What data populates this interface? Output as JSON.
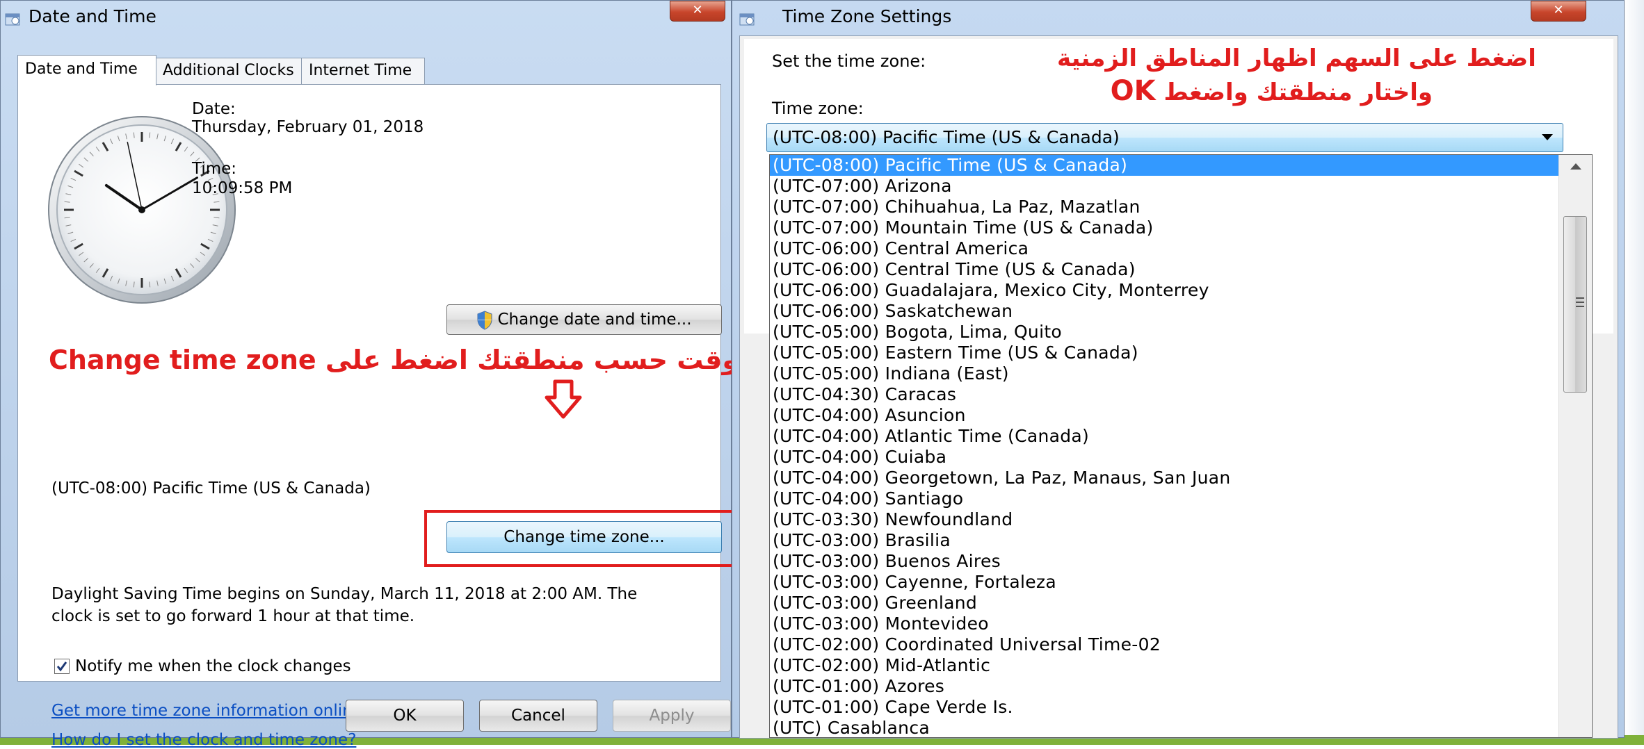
{
  "date_time_window": {
    "title": "Date and Time",
    "close_glyph": "✕",
    "tabs": [
      {
        "label": "Date and Time",
        "active": true
      },
      {
        "label": "Additional Clocks",
        "active": false
      },
      {
        "label": "Internet Time",
        "active": false
      }
    ],
    "clock_time": "10:09:58",
    "date_label": "Date:",
    "date_value": "Thursday, February 01, 2018",
    "time_label": "Time:",
    "time_value": "10:09:58 PM",
    "change_date_button": "Change date and time...",
    "current_timezone": "(UTC-08:00) Pacific Time (US & Canada)",
    "change_tz_button": "Change time zone...",
    "dst_line1": "Daylight Saving Time begins on Sunday, March 11, 2018 at 2:00 AM. The",
    "dst_line2": "clock is set to go forward 1 hour at that time.",
    "notify_checkbox": {
      "label": "Notify me when the clock changes",
      "checked": true
    },
    "link_more_info": "Get more time zone information online",
    "link_how_to": "How do I set the clock and time zone?",
    "ok_button": "OK",
    "cancel_button": "Cancel",
    "apply_button": "Apply"
  },
  "annotations": {
    "left_ar": "لتغيير الوقت حسب منطقتك اضغط على",
    "left_en": "Change time zone",
    "right_line1": "اضغط على السهم اظهار المناطق الزمنية",
    "right_line2": "واختار منطقتك واضغط",
    "right_ok": "OK",
    "highlight_color": "#e11d1d"
  },
  "tz_window": {
    "title": "Time Zone Settings",
    "close_glyph": "✕",
    "set_label": "Set the time zone:",
    "tz_label": "Time zone:",
    "combo_value": "(UTC-08:00) Pacific Time (US & Canada)",
    "selection_color": "#3399ff",
    "options": [
      "(UTC-08:00) Pacific Time (US & Canada)",
      "(UTC-07:00) Arizona",
      "(UTC-07:00) Chihuahua, La Paz, Mazatlan",
      "(UTC-07:00) Mountain Time (US & Canada)",
      "(UTC-06:00) Central America",
      "(UTC-06:00) Central Time (US & Canada)",
      "(UTC-06:00) Guadalajara, Mexico City, Monterrey",
      "(UTC-06:00) Saskatchewan",
      "(UTC-05:00) Bogota, Lima, Quito",
      "(UTC-05:00) Eastern Time (US & Canada)",
      "(UTC-05:00) Indiana (East)",
      "(UTC-04:30) Caracas",
      "(UTC-04:00) Asuncion",
      "(UTC-04:00) Atlantic Time (Canada)",
      "(UTC-04:00) Cuiaba",
      "(UTC-04:00) Georgetown, La Paz, Manaus, San Juan",
      "(UTC-04:00) Santiago",
      "(UTC-03:30) Newfoundland",
      "(UTC-03:00) Brasilia",
      "(UTC-03:00) Buenos Aires",
      "(UTC-03:00) Cayenne, Fortaleza",
      "(UTC-03:00) Greenland",
      "(UTC-03:00) Montevideo",
      "(UTC-02:00) Coordinated Universal Time-02",
      "(UTC-02:00) Mid-Atlantic",
      "(UTC-01:00) Azores",
      "(UTC-01:00) Cape Verde Is.",
      "(UTC) Casablanca"
    ]
  }
}
